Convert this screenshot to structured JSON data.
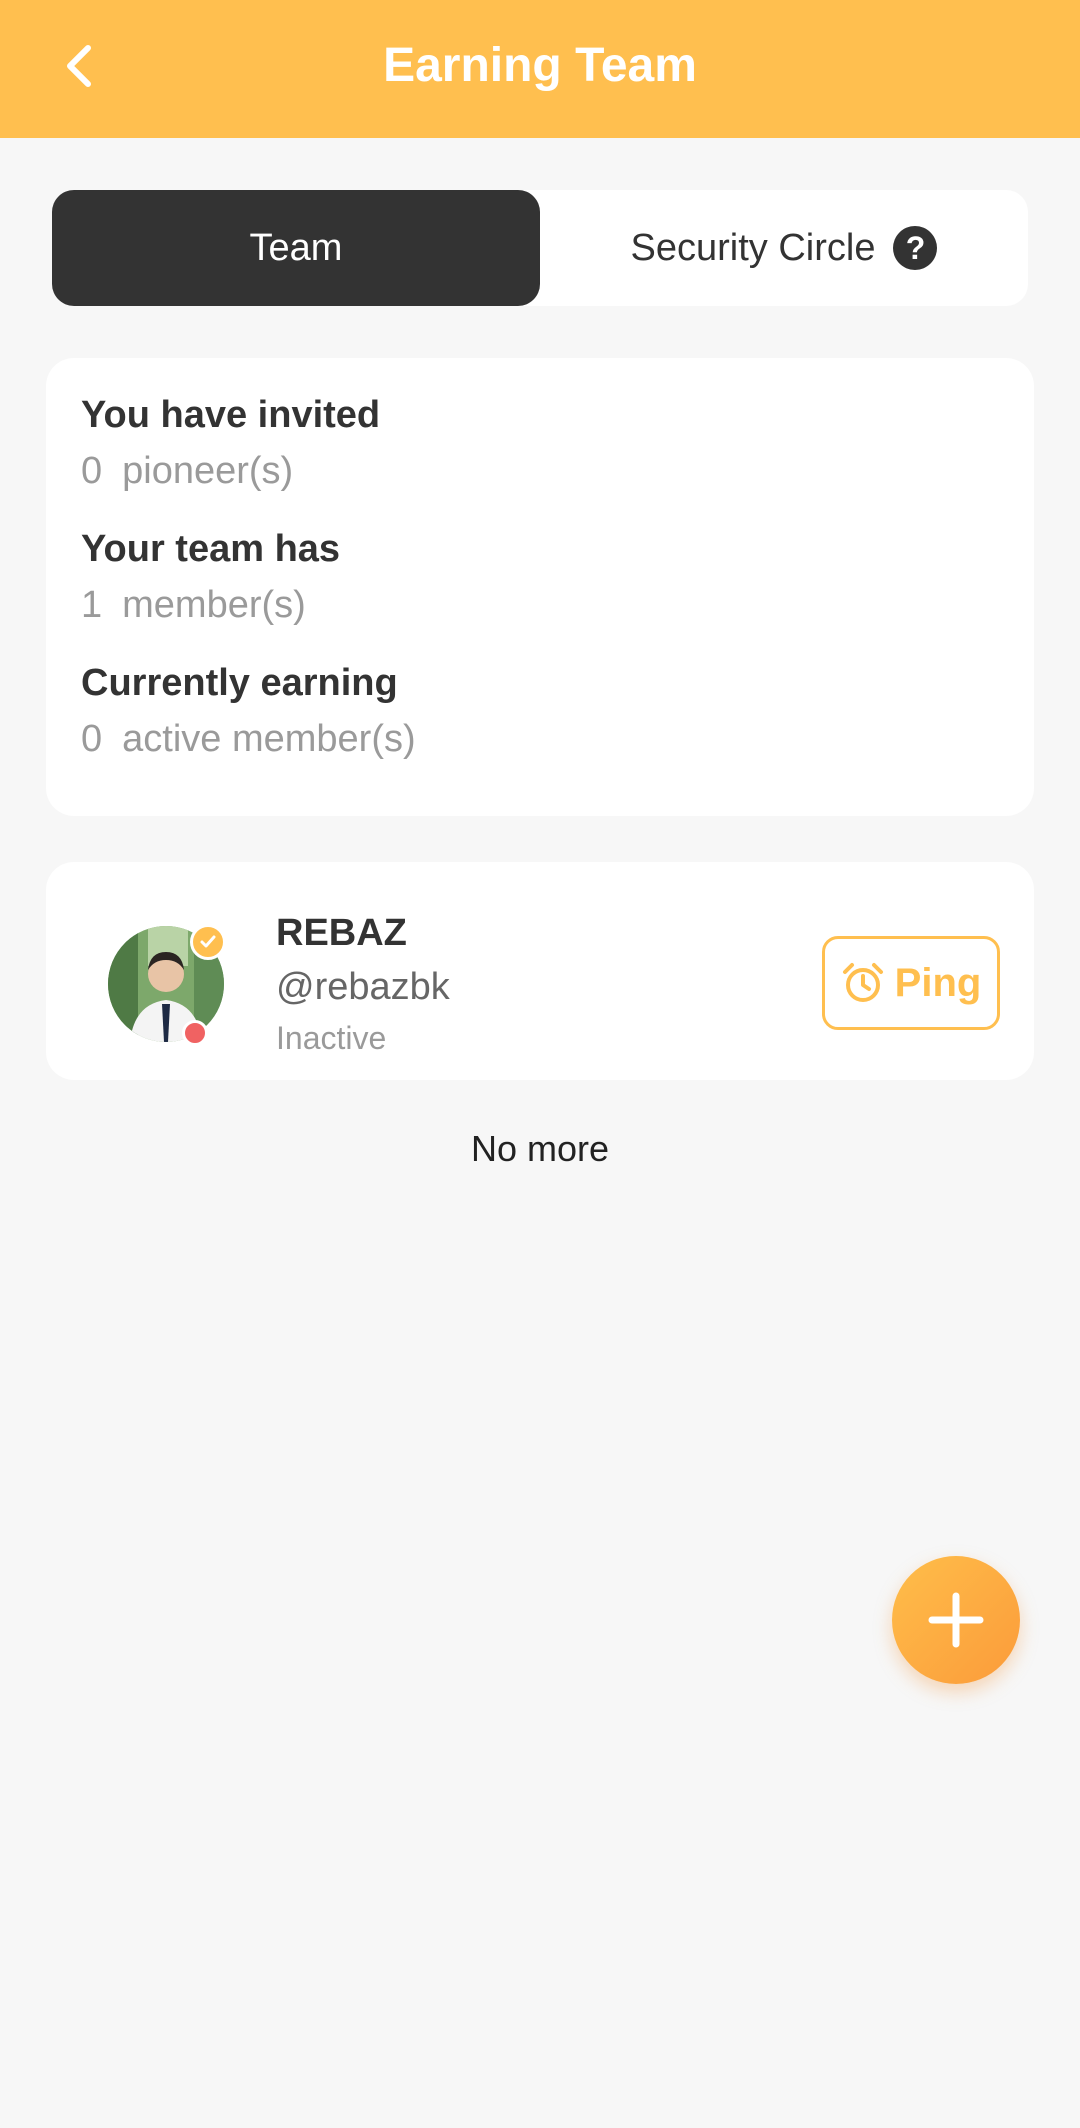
{
  "header": {
    "title": "Earning Team",
    "back_icon": "chevron-left-icon"
  },
  "tabs": [
    {
      "label": "Team",
      "active": true
    },
    {
      "label": "Security Circle",
      "active": false,
      "icon": "help-icon",
      "icon_text": "?"
    }
  ],
  "stats": {
    "invited": {
      "label": "You have invited",
      "value": "0",
      "unit": "pioneer(s)"
    },
    "team": {
      "label": "Your team has",
      "value": "1",
      "unit": "member(s)"
    },
    "earning": {
      "label": "Currently earning",
      "value": "0",
      "unit": "active member(s)"
    }
  },
  "members": [
    {
      "name": "REBAZ",
      "handle": "@rebazbk",
      "status": "Inactive",
      "verified": true,
      "status_color": "#f06262",
      "ping_label": "Ping",
      "ping_icon": "alarm-clock-icon"
    }
  ],
  "footer_text": "No more",
  "fab_icon": "plus-icon",
  "colors": {
    "accent": "#ffbf4f",
    "dark": "#333333",
    "background": "#f7f7f7",
    "inactive_dot": "#f06262"
  }
}
